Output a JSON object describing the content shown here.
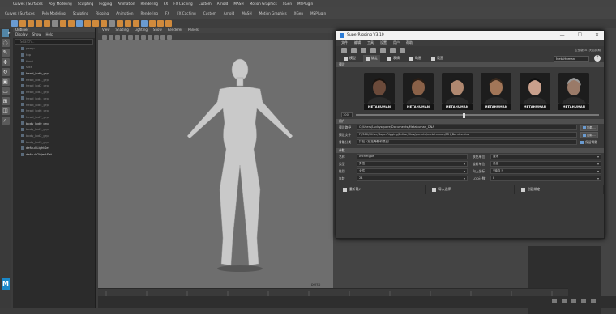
{
  "maya": {
    "menubar": [
      "Curves / Surfaces",
      "Poly Modeling",
      "Sculpting",
      "Rigging",
      "Animation",
      "Rendering",
      "FX",
      "FX Caching",
      "Custom",
      "Arnold",
      "MASH",
      "Motion Graphics",
      "XGen",
      "MSPlugin"
    ],
    "outliner": {
      "title": "Outliner",
      "menus": [
        "Display",
        "Show",
        "Help"
      ],
      "search_placeholder": "Search...",
      "items": [
        "persp",
        "top",
        "front",
        "side",
        "head_lod0_grp",
        "head_lod1_grp",
        "head_lod2_grp",
        "head_lod3_grp",
        "head_lod4_grp",
        "head_lod5_grp",
        "head_lod6_grp",
        "head_lod7_grp",
        "body_lod0_grp",
        "body_lod1_grp",
        "body_lod2_grp",
        "body_lod3_grp",
        "defaultLightSet",
        "defaultObjectSet"
      ],
      "highlighted": [
        4,
        12,
        16,
        17
      ]
    },
    "viewport": {
      "menus": [
        "View",
        "Shading",
        "Lighting",
        "Show",
        "Renderer",
        "Panels"
      ],
      "camera_label": "persp"
    },
    "m_logo": "M"
  },
  "dialog": {
    "title": "SuperRigging V3.10",
    "controls": [
      "—",
      "☐",
      "✕"
    ],
    "menu": [
      "文件",
      "编辑",
      "工具",
      "设置",
      "用户",
      "帮助"
    ],
    "version_text": "企业版101天后到期",
    "tabs": [
      "模型",
      "绑定",
      "表情",
      "动画",
      "设置"
    ],
    "dropdown_value": "MetaHuman",
    "help_label": "?",
    "preset_section": "预设",
    "preset_badge": "METAHUMAN",
    "preset_count": 6,
    "slider": {
      "value": "100",
      "position_fraction": 0.44
    },
    "user_section": "用户",
    "fields": {
      "preset_path_label": "预设路径",
      "preset_path_value": "C:/Users/Luckysquare/Documents/Metahuman_DNA",
      "preset_file_label": "预设文件",
      "preset_file_value": "F:/360/Other/SuperRigging/Editor/files/presets/metahuman/MH_Bernice.dna",
      "skeleton_label": "骨骼分类",
      "skeleton_value": "打包（包括骨骼和蒙皮）",
      "load_button": "加载...",
      "checkbox_label": "保留骨骼"
    },
    "params_section": "参数",
    "params": [
      {
        "label": "名称",
        "value": "Archetype"
      },
      {
        "label": "肤色单位",
        "value": "厘米"
      },
      {
        "label": "类型",
        "value": "男性"
      },
      {
        "label": "旋转单位",
        "value": "角度"
      },
      {
        "label": "性别",
        "value": "女性"
      },
      {
        "label": "向上坐标",
        "value": "Y轴向上"
      },
      {
        "label": "年龄",
        "value": "24"
      },
      {
        "label": "LOD计数",
        "value": "8"
      }
    ],
    "actions": [
      "重新载入",
      "导入选择",
      "创建绑定"
    ]
  }
}
